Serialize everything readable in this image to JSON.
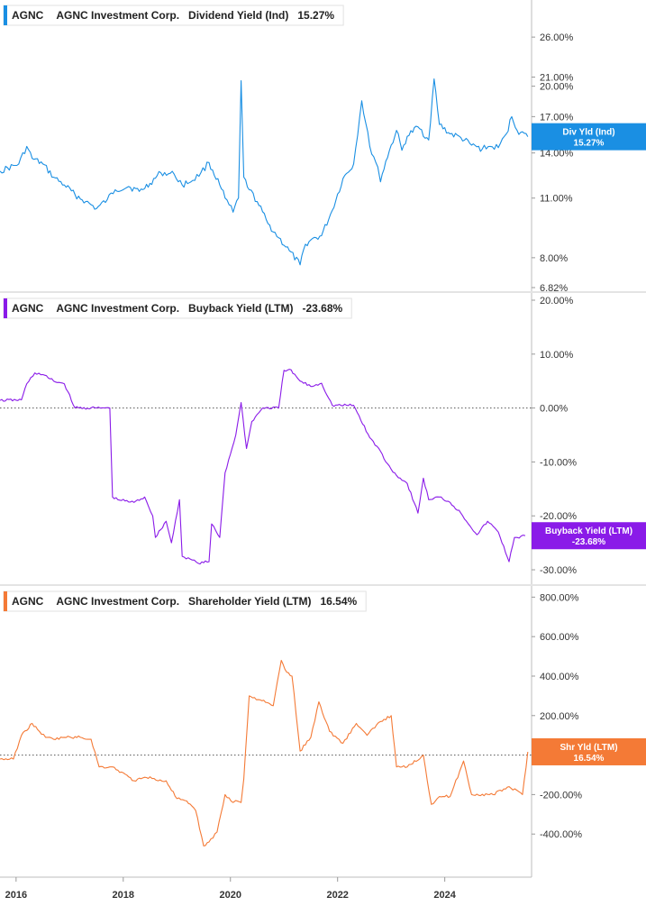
{
  "chart_data": [
    {
      "type": "line",
      "ticker": "AGNC",
      "company": "AGNC Investment Corp.",
      "metric": "Dividend Yield (Ind)",
      "current_value": "15.27%",
      "tag_label": "Div Yld (Ind)",
      "tag_value": "15.27%",
      "color": "#1a8fe3",
      "scale": "log",
      "ylim": [
        6.82,
        30.5
      ],
      "yticks": [
        26,
        21,
        20,
        17,
        14,
        11,
        8,
        6.82
      ],
      "ytick_labels": [
        "26.00%",
        "21.00%",
        "20.00%",
        "17.00%",
        "14.00%",
        "11.00%",
        "8.00%",
        "6.82%"
      ],
      "zero_line": false,
      "x": [
        2015.7,
        2016.05,
        2016.2,
        2016.3,
        2016.5,
        2016.7,
        2016.9,
        2017.1,
        2017.3,
        2017.5,
        2017.7,
        2017.85,
        2018.1,
        2018.3,
        2018.5,
        2018.7,
        2018.95,
        2019.1,
        2019.3,
        2019.45,
        2019.6,
        2019.8,
        2019.9,
        2020.05,
        2020.15,
        2020.2,
        2020.25,
        2020.35,
        2020.5,
        2020.7,
        2020.9,
        2021.1,
        2021.3,
        2021.4,
        2021.5,
        2021.7,
        2021.9,
        2022.1,
        2022.3,
        2022.45,
        2022.6,
        2022.75,
        2022.8,
        2022.9,
        2023.1,
        2023.2,
        2023.3,
        2023.5,
        2023.7,
        2023.8,
        2023.9,
        2024.1,
        2024.3,
        2024.5,
        2024.7,
        2024.85,
        2025.0,
        2025.15,
        2025.25,
        2025.35,
        2025.55
      ],
      "y": [
        12.7,
        13.2,
        14.5,
        13.6,
        13.2,
        12.3,
        11.8,
        11.2,
        10.8,
        10.4,
        10.9,
        11.5,
        11.7,
        11.4,
        11.9,
        12.6,
        12.5,
        11.8,
        12.1,
        12.6,
        13.3,
        11.8,
        11.0,
        10.2,
        11.0,
        20.6,
        12.3,
        11.5,
        10.8,
        9.6,
        8.9,
        8.3,
        7.7,
        8.6,
        8.8,
        9.0,
        10.3,
        12.2,
        13.2,
        18.5,
        14.5,
        13.0,
        12.0,
        13.4,
        15.8,
        14.2,
        15.3,
        16.1,
        15.0,
        20.8,
        16.3,
        15.5,
        15.2,
        14.6,
        14.3,
        14.5,
        14.4,
        15.5,
        17.0,
        15.8,
        15.27
      ]
    },
    {
      "type": "line",
      "ticker": "AGNC",
      "company": "AGNC Investment Corp.",
      "metric": "Buyback Yield (LTM)",
      "current_value": "-23.68%",
      "tag_label": "Buyback Yield (LTM)",
      "tag_value": "-23.68%",
      "color": "#8a1be8",
      "scale": "linear",
      "ylim": [
        -32,
        20
      ],
      "yticks": [
        20,
        10,
        0,
        -10,
        -20,
        -30
      ],
      "ytick_labels": [
        "20.00%",
        "10.00%",
        "0.00%",
        "-10.00%",
        "-20.00%",
        "-30.00%"
      ],
      "zero_line": true,
      "x": [
        2015.7,
        2016.1,
        2016.2,
        2016.35,
        2016.5,
        2016.7,
        2016.9,
        2017.1,
        2017.5,
        2017.75,
        2017.8,
        2017.9,
        2018.2,
        2018.4,
        2018.55,
        2018.6,
        2018.8,
        2018.9,
        2019.05,
        2019.1,
        2019.25,
        2019.4,
        2019.6,
        2019.65,
        2019.8,
        2019.9,
        2020.1,
        2020.2,
        2020.3,
        2020.4,
        2020.6,
        2020.9,
        2021.0,
        2021.1,
        2021.3,
        2021.5,
        2021.7,
        2021.9,
        2022.3,
        2022.6,
        2022.8,
        2022.9,
        2023.1,
        2023.3,
        2023.5,
        2023.6,
        2023.7,
        2023.9,
        2024.1,
        2024.3,
        2024.6,
        2024.8,
        2025.0,
        2025.2,
        2025.3,
        2025.35,
        2025.5
      ],
      "y": [
        1.4,
        1.5,
        4.5,
        6.5,
        6.2,
        5.0,
        4.5,
        0.0,
        0.0,
        0.0,
        -16.5,
        -17.0,
        -17.5,
        -16.5,
        -20.0,
        -24.0,
        -21.0,
        -25.0,
        -17.0,
        -27.5,
        -28.0,
        -28.8,
        -28.5,
        -21.5,
        -24.0,
        -12.0,
        -5.0,
        1.0,
        -7.5,
        -2.5,
        0.0,
        0.0,
        7.0,
        7.2,
        5.0,
        4.0,
        4.6,
        0.5,
        0.5,
        -5.5,
        -8.0,
        -10.0,
        -12.5,
        -14.0,
        -19.5,
        -13.0,
        -17.0,
        -16.5,
        -17.5,
        -19.5,
        -23.5,
        -21.0,
        -23.0,
        -28.5,
        -24.0,
        -24.0,
        -23.68
      ]
    },
    {
      "type": "line",
      "ticker": "AGNC",
      "company": "AGNC Investment Corp.",
      "metric": "Shareholder Yield (LTM)",
      "current_value": "16.54%",
      "tag_label": "Shr Yld (LTM)",
      "tag_value": "16.54%",
      "color": "#f47a36",
      "scale": "linear",
      "ylim": [
        -600,
        820
      ],
      "yticks": [
        800,
        600,
        400,
        200,
        0,
        -200,
        -400
      ],
      "ytick_labels": [
        "800.00%",
        "600.00%",
        "400.00%",
        "200.00%",
        "0.00%",
        "-200.00%",
        "-400.00%"
      ],
      "zero_line": true,
      "x": [
        2015.7,
        2015.95,
        2016.1,
        2016.3,
        2016.4,
        2016.55,
        2016.7,
        2016.9,
        2017.2,
        2017.4,
        2017.55,
        2017.75,
        2017.8,
        2018.1,
        2018.2,
        2018.5,
        2018.65,
        2018.8,
        2019.0,
        2019.15,
        2019.35,
        2019.5,
        2019.6,
        2019.75,
        2019.9,
        2020.05,
        2020.1,
        2020.2,
        2020.25,
        2020.35,
        2020.55,
        2020.8,
        2020.95,
        2021.05,
        2021.15,
        2021.3,
        2021.5,
        2021.65,
        2021.85,
        2022.1,
        2022.35,
        2022.55,
        2022.8,
        2023.0,
        2023.1,
        2023.2,
        2023.3,
        2023.6,
        2023.75,
        2023.9,
        2024.1,
        2024.35,
        2024.5,
        2024.9,
        2025.2,
        2025.45,
        2025.55
      ],
      "y": [
        -20,
        -20,
        100,
        160,
        130,
        90,
        80,
        90,
        90,
        80,
        -60,
        -60,
        -60,
        -110,
        -130,
        -110,
        -130,
        -130,
        -220,
        -230,
        -280,
        -460,
        -440,
        -390,
        -200,
        -240,
        -230,
        -240,
        -120,
        300,
        280,
        250,
        480,
        420,
        400,
        20,
        90,
        270,
        120,
        60,
        160,
        100,
        170,
        200,
        -60,
        -60,
        -60,
        0,
        -250,
        -210,
        -210,
        -30,
        -200,
        -200,
        -160,
        -200,
        16.54
      ]
    }
  ],
  "x_axis": {
    "range": [
      2015.7,
      2025.62
    ],
    "ticks": [
      2016,
      2018,
      2020,
      2022,
      2024
    ],
    "tick_labels": [
      "2016",
      "2018",
      "2020",
      "2022",
      "2024"
    ]
  }
}
